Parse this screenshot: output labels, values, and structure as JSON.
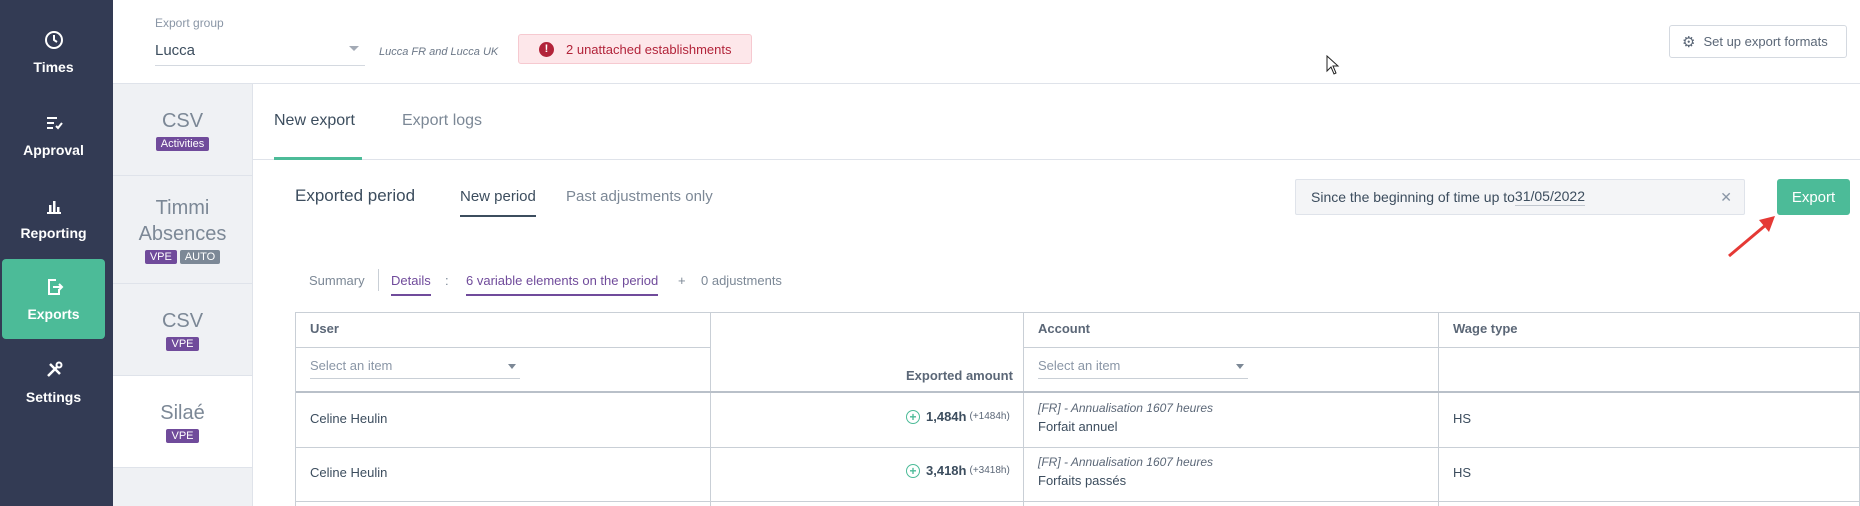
{
  "sidebar": {
    "items": [
      {
        "label": "Times",
        "icon": "clock-icon"
      },
      {
        "label": "Approval",
        "icon": "approval-icon"
      },
      {
        "label": "Reporting",
        "icon": "chart-icon"
      },
      {
        "label": "Exports",
        "icon": "export-icon",
        "active": true
      },
      {
        "label": "Settings",
        "icon": "tools-icon"
      }
    ]
  },
  "topbar": {
    "export_group_label": "Export group",
    "export_group_value": "Lucca",
    "export_group_sub": "Lucca FR and Lucca UK",
    "warning": "2 unattached establishments",
    "setup_button": "Set up export formats"
  },
  "formats": [
    {
      "name": "CSV",
      "tags": [
        "Activities"
      ]
    },
    {
      "name": "Timmi Absences",
      "tags": [
        "VPE",
        "AUTO"
      ]
    },
    {
      "name": "CSV",
      "tags": [
        "VPE"
      ]
    },
    {
      "name": "Silaé",
      "tags": [
        "VPE"
      ],
      "active": true
    }
  ],
  "tabs": {
    "new_export": "New export",
    "export_logs": "Export logs"
  },
  "period": {
    "title": "Exported period",
    "new_period": "New period",
    "past_adjustments": "Past adjustments only",
    "range_prefix": "Since the beginning of time  up to",
    "range_date": "31/05/2022",
    "export_button": "Export"
  },
  "details": {
    "summary": "Summary",
    "details": "Details",
    "colon": ":",
    "variable_elements": "6 variable elements on the period",
    "plus": "+",
    "adjustments": "0 adjustments"
  },
  "table": {
    "headers": {
      "user": "User",
      "amount": "Exported amount",
      "account": "Account",
      "wage_type": "Wage type"
    },
    "filter_placeholder": "Select an item",
    "rows": [
      {
        "user": "Celine Heulin",
        "amount": "1,484h",
        "amount_detail": "(+1484h)",
        "account_line1": "[FR] - Annualisation 1607 heures",
        "account_line2": "Forfait annuel",
        "wage_type": "HS"
      },
      {
        "user": "Celine Heulin",
        "amount": "3,418h",
        "amount_detail": "(+3418h)",
        "account_line1": "[FR] - Annualisation 1607 heures",
        "account_line2": "Forfaits passés",
        "wage_type": "HS"
      }
    ]
  },
  "colors": {
    "sidebar_bg": "#333b54",
    "accent_green": "#4cbb98",
    "purple": "#704b9b",
    "warning_red": "#b2243a"
  }
}
